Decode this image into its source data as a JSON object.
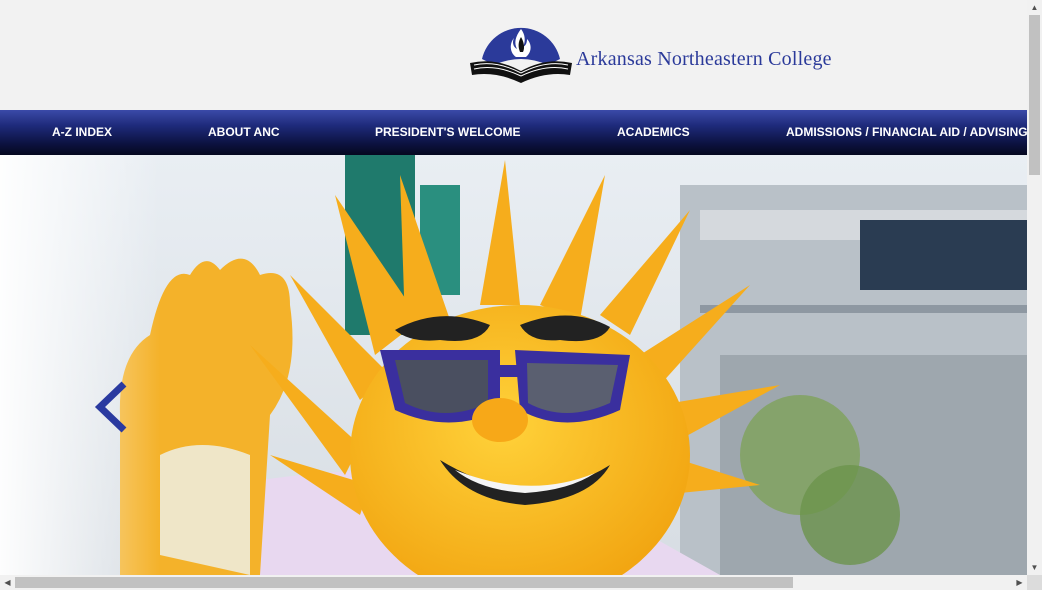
{
  "header": {
    "college_name": "Arkansas Northeastern College"
  },
  "nav": {
    "items": [
      {
        "label": "A-Z INDEX"
      },
      {
        "label": "ABOUT ANC"
      },
      {
        "label": "PRESIDENT'S WELCOME"
      },
      {
        "label": "ACADEMICS"
      },
      {
        "label": "ADMISSIONS / FINANCIAL AID / ADVISING"
      }
    ]
  },
  "colors": {
    "brand_blue": "#2b3a9a",
    "nav_dark": "#0c1240",
    "mascot_yellow": "#f5b21c",
    "arrow_blue": "#2a3aa0"
  },
  "hero": {
    "icon": "chevron-left-icon"
  }
}
